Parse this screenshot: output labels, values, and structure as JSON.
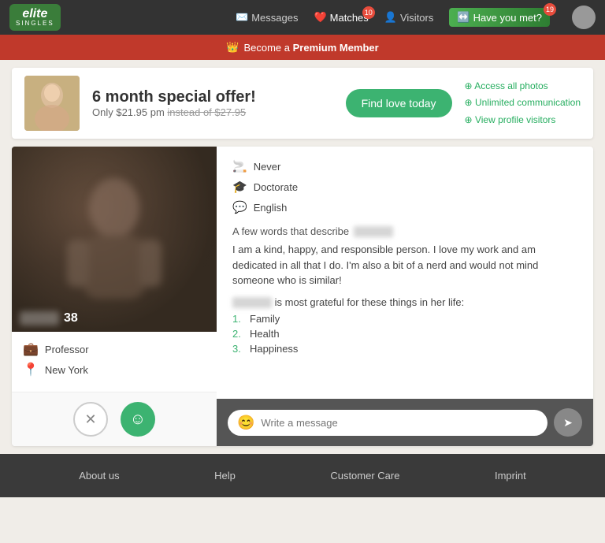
{
  "navbar": {
    "logo_elite": "elite",
    "logo_singles": "SINGLES",
    "messages_label": "Messages",
    "matches_label": "Matches",
    "matches_badge": "10",
    "visitors_label": "Visitors",
    "haveyoumet_label": "Have you met?",
    "haveyoumet_badge": "19"
  },
  "premium_banner": {
    "text_pre": "Become a",
    "text_bold": "Premium Member"
  },
  "offer": {
    "headline": "6 month special offer!",
    "price": "Only $21.95 pm",
    "original_price": "instead of $27.95",
    "cta": "Find love today",
    "features": [
      "Access all photos",
      "Unlimited communication",
      "View profile visitors"
    ]
  },
  "profile": {
    "age": "38",
    "profession": "Professor",
    "location": "New York",
    "details": [
      {
        "icon": "🚬",
        "text": "Never"
      },
      {
        "icon": "🎓",
        "text": "Doctorate"
      },
      {
        "icon": "💬",
        "text": "English"
      }
    ],
    "describe_label": "A few words that describe",
    "bio": "I am a kind, happy, and responsible person. I love my work and am dedicated in all that I do. I'm also a bit of a nerd and would not mind someone who is similar!",
    "grateful_intro": "is most grateful for these things in her life:",
    "grateful_items": [
      "Family",
      "Health",
      "Happiness"
    ]
  },
  "message": {
    "placeholder": "Write a message"
  },
  "footer": {
    "links": [
      "About us",
      "Help",
      "Customer Care",
      "Imprint"
    ]
  }
}
